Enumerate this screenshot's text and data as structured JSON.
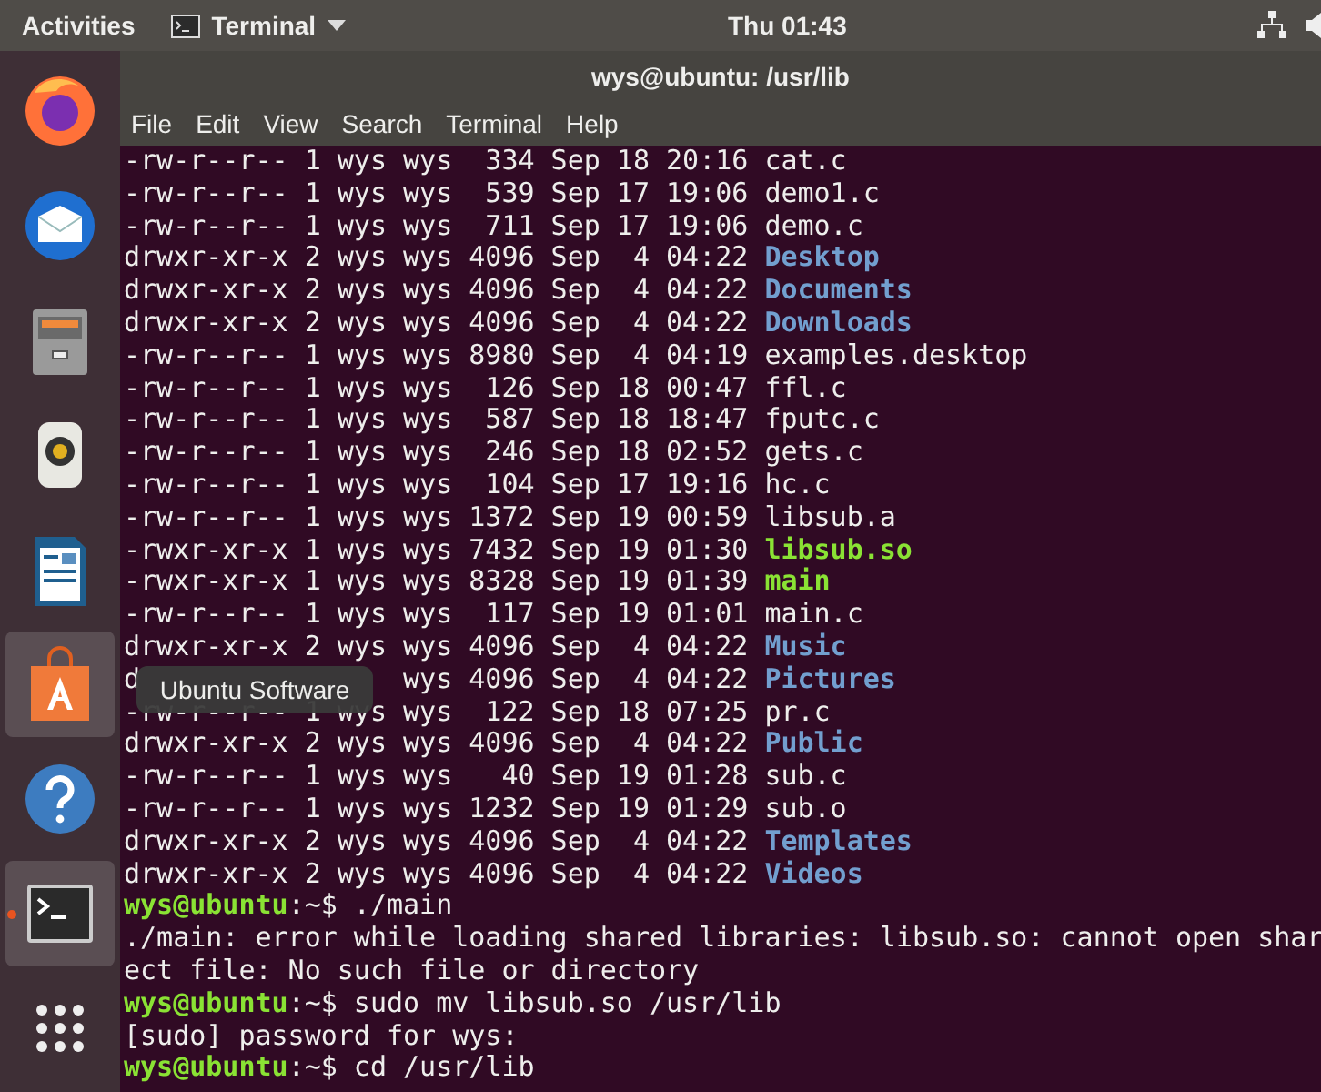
{
  "top_bar": {
    "activities": "Activities",
    "app_menu": "Terminal",
    "clock": "Thu 01:43"
  },
  "dock": {
    "items": [
      {
        "kind": "firefox",
        "running": false,
        "highlighted": false
      },
      {
        "kind": "mail",
        "running": false,
        "highlighted": false
      },
      {
        "kind": "files",
        "running": false,
        "highlighted": false
      },
      {
        "kind": "speaker",
        "running": false,
        "highlighted": false
      },
      {
        "kind": "writer",
        "running": false,
        "highlighted": false
      },
      {
        "kind": "software",
        "running": false,
        "highlighted": true
      },
      {
        "kind": "help",
        "running": false,
        "highlighted": false
      },
      {
        "kind": "terminal",
        "running": true,
        "highlighted": true
      },
      {
        "kind": "apps",
        "running": false,
        "highlighted": false
      }
    ],
    "tooltip": "Ubuntu Software"
  },
  "window": {
    "title": "wys@ubuntu: /usr/lib",
    "menu": [
      "File",
      "Edit",
      "View",
      "Search",
      "Terminal",
      "Help"
    ]
  },
  "lines": [
    {
      "kind": "regular",
      "details": "-rw-r--r-- 1 wys wys  334 Sep 18 20:16",
      "name": "cat.c"
    },
    {
      "kind": "regular",
      "details": "-rw-r--r-- 1 wys wys  539 Sep 17 19:06",
      "name": "demo1.c"
    },
    {
      "kind": "regular",
      "details": "-rw-r--r-- 1 wys wys  711 Sep 17 19:06",
      "name": "demo.c"
    },
    {
      "kind": "directory",
      "details": "drwxr-xr-x 2 wys wys 4096 Sep  4 04:22",
      "name": "Desktop"
    },
    {
      "kind": "directory",
      "details": "drwxr-xr-x 2 wys wys 4096 Sep  4 04:22",
      "name": "Documents"
    },
    {
      "kind": "directory",
      "details": "drwxr-xr-x 2 wys wys 4096 Sep  4 04:22",
      "name": "Downloads"
    },
    {
      "kind": "regular",
      "details": "-rw-r--r-- 1 wys wys 8980 Sep  4 04:19",
      "name": "examples.desktop"
    },
    {
      "kind": "regular",
      "details": "-rw-r--r-- 1 wys wys  126 Sep 18 00:47",
      "name": "ffl.c"
    },
    {
      "kind": "regular",
      "details": "-rw-r--r-- 1 wys wys  587 Sep 18 18:47",
      "name": "fputc.c"
    },
    {
      "kind": "regular",
      "details": "-rw-r--r-- 1 wys wys  246 Sep 18 02:52",
      "name": "gets.c"
    },
    {
      "kind": "regular",
      "details": "-rw-r--r-- 1 wys wys  104 Sep 17 19:16",
      "name": "hc.c"
    },
    {
      "kind": "regular",
      "details": "-rw-r--r-- 1 wys wys 1372 Sep 19 00:59",
      "name": "libsub.a"
    },
    {
      "kind": "executable",
      "details": "-rwxr-xr-x 1 wys wys 7432 Sep 19 01:30",
      "name": "libsub.so"
    },
    {
      "kind": "executable",
      "details": "-rwxr-xr-x 1 wys wys 8328 Sep 19 01:39",
      "name": "main"
    },
    {
      "kind": "regular",
      "details": "-rw-r--r-- 1 wys wys  117 Sep 19 01:01",
      "name": "main.c"
    },
    {
      "kind": "directory",
      "details": "drwxr-xr-x 2 wys wys 4096 Sep  4 04:22",
      "name": "Music"
    },
    {
      "kind": "directory",
      "lead": "d",
      "details": "wys 4096 Sep  4 04:22",
      "name": "Pictures"
    },
    {
      "kind": "regular",
      "details": "-rw-r--r-- 1 wys wys  122 Sep 18 07:25",
      "name": "pr.c"
    },
    {
      "kind": "directory",
      "details": "drwxr-xr-x 2 wys wys 4096 Sep  4 04:22",
      "name": "Public"
    },
    {
      "kind": "regular",
      "details": "-rw-r--r-- 1 wys wys   40 Sep 19 01:28",
      "name": "sub.c"
    },
    {
      "kind": "regular",
      "details": "-rw-r--r-- 1 wys wys 1232 Sep 19 01:29",
      "name": "sub.o"
    },
    {
      "kind": "directory",
      "details": "drwxr-xr-x 2 wys wys 4096 Sep  4 04:22",
      "name": "Templates"
    },
    {
      "kind": "directory",
      "details": "drwxr-xr-x 2 wys wys 4096 Sep  4 04:22",
      "name": "Videos"
    },
    {
      "kind": "prompt",
      "prompt": "wys@ubuntu",
      "rest": ":~$ ./main"
    },
    {
      "kind": "output",
      "text": "./main: error while loading shared libraries: libsub.so: cannot open shar"
    },
    {
      "kind": "output",
      "text": "ect file: No such file or directory"
    },
    {
      "kind": "prompt",
      "prompt": "wys@ubuntu",
      "rest": ":~$ sudo mv libsub.so /usr/lib"
    },
    {
      "kind": "output",
      "text": "[sudo] password for wys:"
    },
    {
      "kind": "prompt",
      "prompt": "wys@ubuntu",
      "rest": ":~$ cd /usr/lib"
    }
  ]
}
